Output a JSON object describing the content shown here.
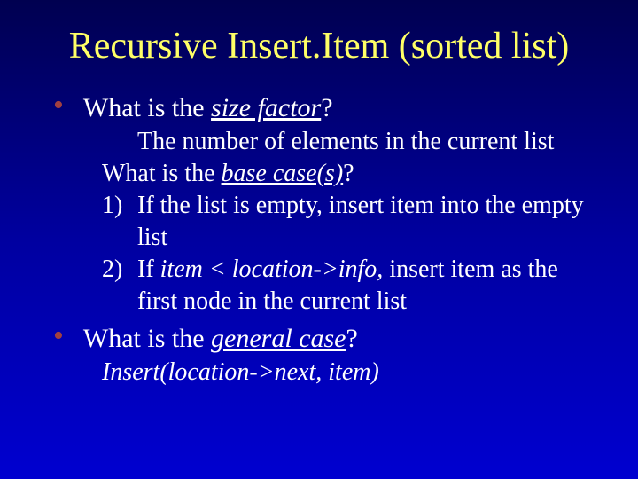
{
  "title": "Recursive Insert.Item (sorted list)",
  "b1": {
    "pre": "What is the ",
    "em": "size factor",
    "post": "?"
  },
  "ans1": "The number of elements in the current list",
  "b2": {
    "pre": "What is the ",
    "em": "base case(s)",
    "post": "?"
  },
  "n1": {
    "label": "1)",
    "text": "If the list is empty, insert item into the empty list"
  },
  "n2": {
    "label": "2)",
    "pre": "If  ",
    "em": "item < location->info,",
    "post": " insert item as the first node in the current list"
  },
  "b3": {
    "pre": "What is the ",
    "em": "general case",
    "post": "?"
  },
  "ans3": "Insert(location->next, item)"
}
